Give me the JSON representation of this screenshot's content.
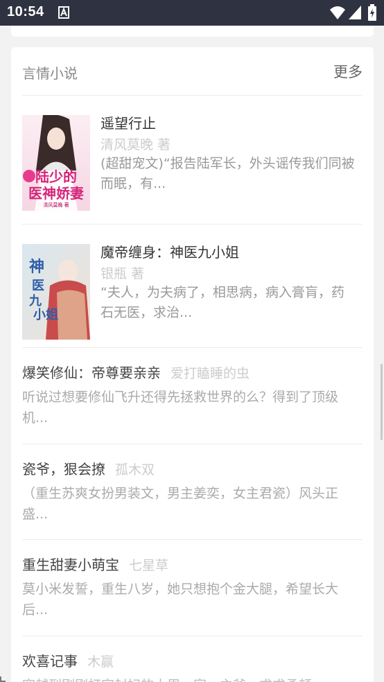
{
  "status_bar": {
    "time": "10:54"
  },
  "section": {
    "title": "言情小说",
    "more": "更多"
  },
  "featured_books": [
    {
      "title": "遥望行止",
      "author": "清风莫晚 著",
      "description": "(超甜宠文)“报告陆军长，外头谣传我们同被而眠，有...",
      "cover": {
        "title_text": "陆少的医神娇妻",
        "author_text": "清风莫晚 著"
      }
    },
    {
      "title": "魔帝缠身：神医九小姐",
      "author": "银瓶 著",
      "description": "“夫人，为夫病了，相思病，病入膏肓，药石无医，求治...",
      "cover": {
        "title_text": "神医九小姐"
      }
    }
  ],
  "list_books": [
    {
      "title": "爆笑修仙：帝尊要亲亲",
      "author": "爱打瞌睡的虫",
      "description": "听说过想要修仙飞升还得先拯救世界的么？得到了顶级机..."
    },
    {
      "title": "瓷爷，狠会撩",
      "author": "孤木双",
      "description": "（重生苏爽女扮男装文，男主姜奕，女主君瓷）风头正盛..."
    },
    {
      "title": "重生甜妻小萌宝",
      "author": "七星草",
      "description": "莫小米发誓，重生八岁，她只想抱个金大腿，希望长大后..."
    },
    {
      "title": "欢喜记事",
      "author": "木赢",
      "description": "穿越到刚刚打完封妃的大周，家、主爷，求求柔顿..."
    }
  ]
}
